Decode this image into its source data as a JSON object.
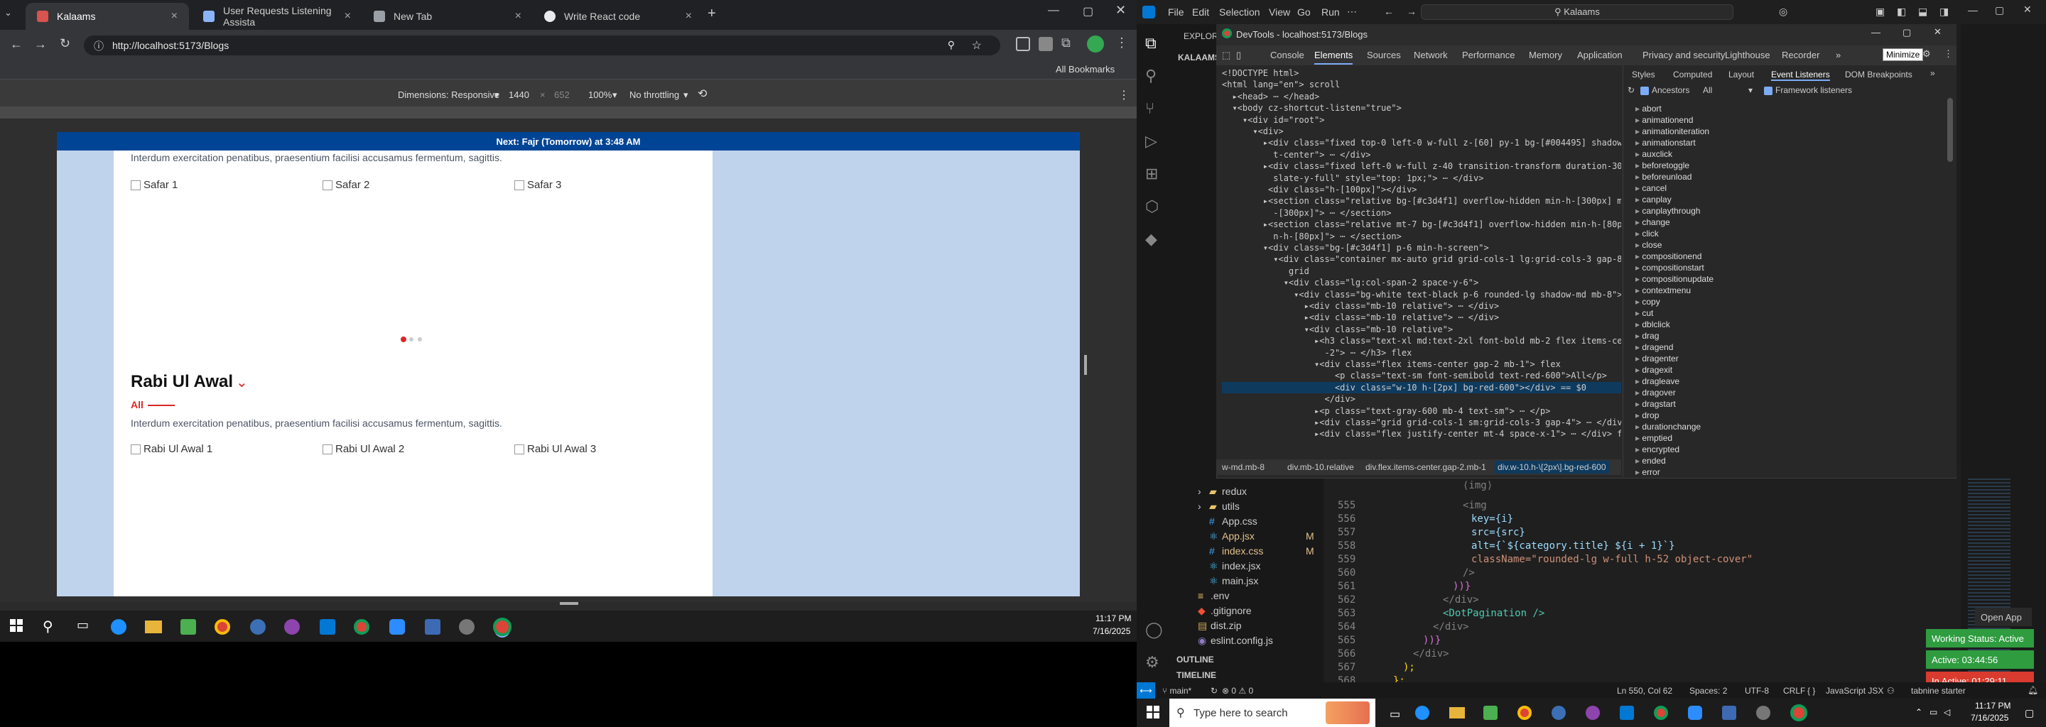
{
  "browser": {
    "tabs": [
      {
        "title": "Kalaams",
        "active": true,
        "favicon_color": "#d9534f"
      },
      {
        "title": "User Requests Listening Assista",
        "favicon_color": "#8ab4f8"
      },
      {
        "title": "New Tab",
        "favicon_color": "#9aa0a6"
      },
      {
        "title": "Write React code",
        "favicon_color": "#e8eaed"
      }
    ],
    "url": "http://localhost:5173/Blogs",
    "bookmarks_label": "All Bookmarks",
    "device": {
      "dimensions": "Dimensions: Responsive",
      "width": "1440",
      "x": "×",
      "height": "652",
      "zoom": "100%",
      "throttle": "No throttling"
    }
  },
  "site": {
    "banner": "Next: Fajr (Tomorrow) at 3:48 AM",
    "top_desc": "Interdum exercitation penatibus, praesentium facilisi accusamus fermentum, sagittis.",
    "safar_images": [
      "Safar 1",
      "Safar 2",
      "Safar 3"
    ],
    "section_title": "Rabi Ul Awal",
    "all_label": "All",
    "section_desc": "Interdum exercitation penatibus, praesentium facilisi accusamus fermentum, sagittis.",
    "rabi_images": [
      "Rabi Ul Awal 1",
      "Rabi Ul Awal 2",
      "Rabi Ul Awal 3"
    ]
  },
  "taskbar_left": {
    "time": "11:17 PM",
    "date": "7/16/2025"
  },
  "devtools": {
    "title": "DevTools - localhost:5173/Blogs",
    "tabs": [
      "Console",
      "Elements",
      "Sources",
      "Network",
      "Performance",
      "Memory",
      "Application",
      "Privacy and security",
      "Lighthouse",
      "Recorder"
    ],
    "active_tab": "Elements",
    "side_tabs": [
      "Styles",
      "Computed",
      "Layout",
      "Event Listeners",
      "DOM Breakpoints"
    ],
    "tooltip": "Minimize",
    "ancestors": "Ancestors",
    "all": "All",
    "framework": "Framework listeners",
    "dom_lines": [
      "<!DOCTYPE html>",
      "<html lang=\"en\"> scroll",
      "  ▸<head> ⋯ </head>",
      "  ▾<body cz-shortcut-listen=\"true\">",
      "    ▾<div id=\"root\">",
      "      ▾<div>",
      "        ▸<div class=\"fixed top-0 left-0 w-full z-[60] py-1 bg-[#004495] shadow-md tex",
      "          t-center\"> ⋯ </div>",
      "        ▸<div class=\"fixed left-0 w-full z-40 transition-transform duration-300 -tran",
      "          slate-y-full\" style=\"top: 1px;\"> ⋯ </div>",
      "         <div class=\"h-[100px]\"></div>",
      "        ▸<section class=\"relative bg-[#c3d4f1] overflow-hidden min-h-[300px] md:min-h",
      "          -[300px]\"> ⋯ </section>",
      "        ▸<section class=\"relative mt-7 bg-[#c3d4f1] overflow-hidden min-h-[80px] md:mi",
      "          n-h-[80px]\"> ⋯ </section>",
      "        ▾<div class=\"bg-[#c3d4f1] p-6 min-h-screen\">",
      "          ▾<div class=\"container mx-auto grid grid-cols-1 lg:grid-cols-3 gap-8\">",
      "             grid",
      "            ▾<div class=\"lg:col-span-2 space-y-6\">",
      "              ▾<div class=\"bg-white text-black p-6 rounded-lg shadow-md mb-8\">",
      "                ▸<div class=\"mb-10 relative\"> ⋯ </div>",
      "                ▸<div class=\"mb-10 relative\"> ⋯ </div>",
      "                ▾<div class=\"mb-10 relative\">",
      "                  ▸<h3 class=\"text-xl md:text-2xl font-bold mb-2 flex items-center gap",
      "                    -2\"> ⋯ </h3> flex",
      "                  ▾<div class=\"flex items-center gap-2 mb-1\"> flex",
      "                      <p class=\"text-sm font-semibold text-red-600\">All</p>",
      "                      <div class=\"w-10 h-[2px] bg-red-600\"></div> == $0",
      "                    </div>",
      "                  ▸<p class=\"text-gray-600 mb-4 text-sm\"> ⋯ </p>",
      "                  ▸<div class=\"grid grid-cols-1 sm:grid-cols-3 gap-4\"> ⋯ </div> grid",
      "                  ▸<div class=\"flex justify-center mt-4 space-x-1\"> ⋯ </div> flex"
    ],
    "breadcrumbs": [
      "w-md.mb-8",
      "div.mb-10.relative",
      "div.flex.items-center.gap-2.mb-1",
      "div.w-10.h-\\[2px\\].bg-red-600"
    ],
    "events": [
      "abort",
      "animationend",
      "animationiteration",
      "animationstart",
      "auxclick",
      "beforetoggle",
      "beforeunload",
      "cancel",
      "canplay",
      "canplaythrough",
      "change",
      "click",
      "close",
      "compositionend",
      "compositionstart",
      "compositionupdate",
      "contextmenu",
      "copy",
      "cut",
      "dblclick",
      "drag",
      "dragend",
      "dragenter",
      "dragexit",
      "dragleave",
      "dragover",
      "dragstart",
      "drop",
      "durationchange",
      "emptied",
      "encrypted",
      "ended",
      "error"
    ]
  },
  "vscode": {
    "menu": [
      "File",
      "Edit",
      "Selection",
      "View",
      "Go",
      "Run"
    ],
    "search": "Kalaams",
    "explorer": "EXPLORER",
    "project": "KALAAMS",
    "files": [
      {
        "name": "redux",
        "type": "folder"
      },
      {
        "name": "utils",
        "type": "folder"
      },
      {
        "name": "App.css",
        "type": "css"
      },
      {
        "name": "App.jsx",
        "type": "jsx",
        "status": "M"
      },
      {
        "name": "index.css",
        "type": "css",
        "status": "M"
      },
      {
        "name": "index.jsx",
        "type": "jsx"
      },
      {
        "name": "main.jsx",
        "type": "jsx"
      },
      {
        "name": ".env",
        "type": "env"
      },
      {
        "name": ".gitignore",
        "type": "git"
      },
      {
        "name": "dist.zip",
        "type": "zip"
      },
      {
        "name": "eslint.config.js",
        "type": "js"
      }
    ],
    "outline": "OUTLINE",
    "timeline": "TIMELINE",
    "code": [
      {
        "n": "555",
        "t": "<img"
      },
      {
        "n": "556",
        "t": "key={i}"
      },
      {
        "n": "557",
        "t": "src={src}"
      },
      {
        "n": "558",
        "t": "alt={`${category.title} ${i + 1}`}"
      },
      {
        "n": "559",
        "t": "className=\"rounded-lg w-full h-52 object-cover\""
      },
      {
        "n": "560",
        "t": "/>"
      },
      {
        "n": "561",
        "t": "))}"
      },
      {
        "n": "562",
        "t": "</div>"
      },
      {
        "n": "563",
        "t": "<DotPagination />"
      },
      {
        "n": "564",
        "t": "</div>"
      },
      {
        "n": "565",
        "t": "))}"
      },
      {
        "n": "566",
        "t": "</div>"
      },
      {
        "n": "567",
        "t": ");"
      },
      {
        "n": "568",
        "t": "};"
      },
      {
        "n": "569",
        "t": ""
      }
    ],
    "status": {
      "branch": "main*",
      "problems": "⊗ 0 ⚠ 0",
      "position": "Ln 550, Col 62",
      "spaces": "Spaces: 2",
      "encoding": "UTF-8",
      "eol": "CRLF",
      "lang": "JavaScript JSX",
      "tabnine": "tabnine starter"
    },
    "notifications": {
      "open_app": "Open App",
      "working": "Working Status: Active",
      "active": "Active: 03:44:56",
      "inactive": "In Active: 01:29:11"
    }
  },
  "taskbar_right": {
    "search": "Type here to search",
    "time": "11:17 PM",
    "date": "7/16/2025"
  }
}
